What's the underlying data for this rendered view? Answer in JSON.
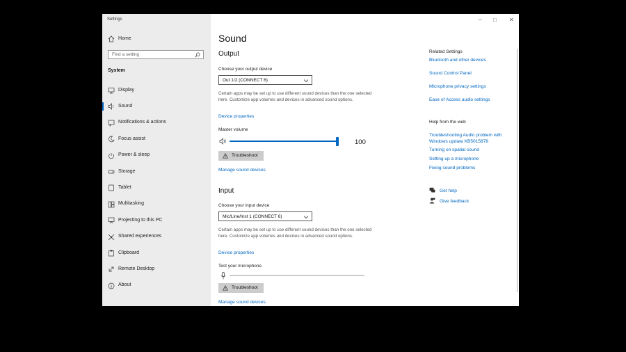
{
  "window": {
    "title": "Settings"
  },
  "sidebar": {
    "home": "Home",
    "search_placeholder": "Find a setting",
    "section": "System",
    "items": [
      {
        "label": "Display",
        "icon": "monitor-icon"
      },
      {
        "label": "Sound",
        "icon": "speaker-icon",
        "active": true
      },
      {
        "label": "Notifications & actions",
        "icon": "notification-icon"
      },
      {
        "label": "Focus assist",
        "icon": "moon-icon"
      },
      {
        "label": "Power & sleep",
        "icon": "power-icon"
      },
      {
        "label": "Storage",
        "icon": "storage-icon"
      },
      {
        "label": "Tablet",
        "icon": "tablet-icon"
      },
      {
        "label": "Multitasking",
        "icon": "multitasking-icon"
      },
      {
        "label": "Projecting to this PC",
        "icon": "projecting-icon"
      },
      {
        "label": "Shared experiences",
        "icon": "shared-icon"
      },
      {
        "label": "Clipboard",
        "icon": "clipboard-icon"
      },
      {
        "label": "Remote Desktop",
        "icon": "remote-icon"
      },
      {
        "label": "About",
        "icon": "info-icon"
      }
    ]
  },
  "main": {
    "title": "Sound",
    "output": {
      "heading": "Output",
      "device_label": "Choose your output device",
      "device_value": "Out 1/2 (CONNECT 6)",
      "description": "Certain apps may be set up to use different sound devices than the one selected here. Customize app volumes and devices in advanced sound options.",
      "properties_link": "Device properties",
      "volume_label": "Master volume",
      "volume_value": "100",
      "volume_level": 1.0,
      "troubleshoot": "Troubleshoot",
      "manage_link": "Manage sound devices"
    },
    "input": {
      "heading": "Input",
      "device_label": "Choose your input device",
      "device_value": "Mic/Line/Inst 1 (CONNECT 6)",
      "description": "Certain apps may be set up to use different sound devices than the one selected here. Customize app volumes and devices in advanced sound options.",
      "properties_link": "Device properties",
      "test_label": "Test your microphone",
      "troubleshoot": "Troubleshoot",
      "manage_link": "Manage sound devices"
    }
  },
  "related": {
    "heading": "Related Settings",
    "links": [
      "Bluetooth and other devices",
      "Sound Control Panel",
      "Microphone privacy settings",
      "Ease of Access audio settings"
    ]
  },
  "web_help": {
    "heading": "Help from the web",
    "links": [
      "Troubleshooting Audio problem with Windows update KB5015878",
      "Turning on spatial sound",
      "Setting up a microphone",
      "Fixing sound problems"
    ]
  },
  "support": {
    "get_help": "Get help",
    "feedback": "Give feedback"
  },
  "colors": {
    "accent": "#0067c0",
    "sidebar_bg": "#ececec",
    "background": "#000000"
  }
}
